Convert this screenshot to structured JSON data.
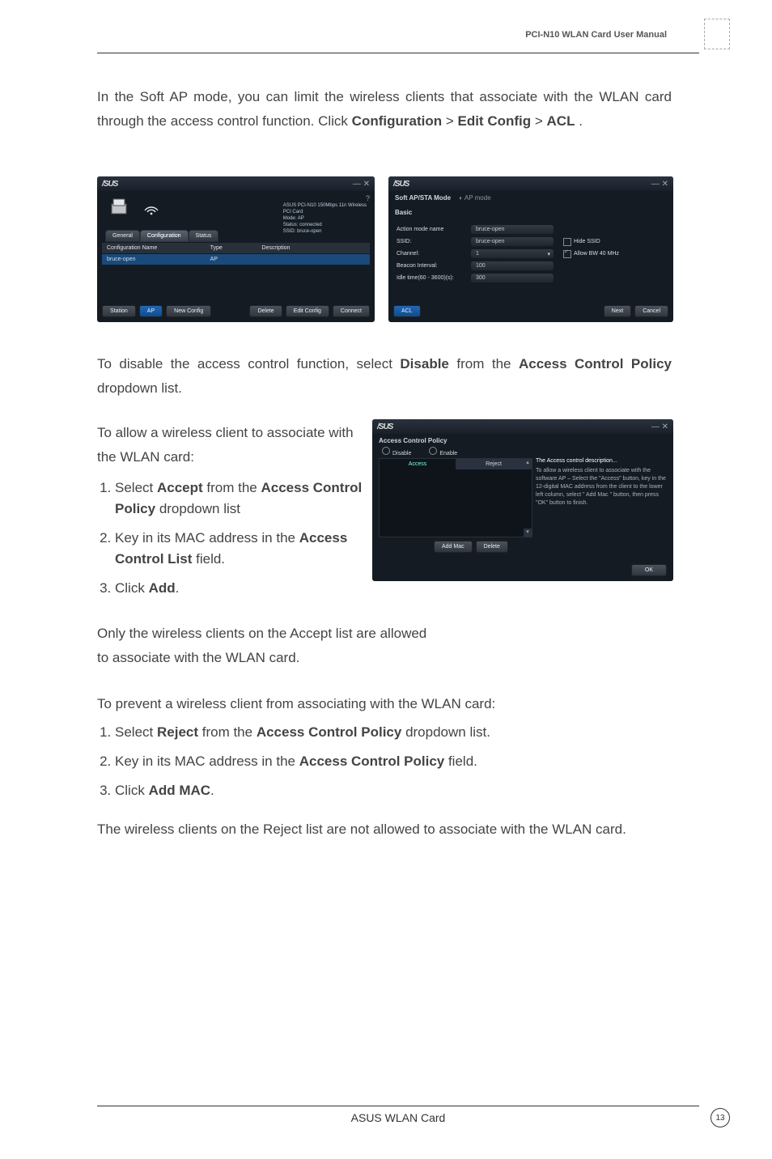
{
  "header": {
    "docTitle": "PCI-N10 WLAN Card User Manual"
  },
  "para1_a": "In the Soft AP mode, you can limit the wireless clients that associate with the WLAN card through the access control function. Click ",
  "para1_b": "Configuration",
  "para1_c": " > ",
  "para1_d": "Edit Config",
  "para1_e": " > ",
  "para1_f": "ACL",
  "para1_g": ".",
  "shot1": {
    "brand": "/SUS",
    "info_l1": "ASUS PCI-N10 150Mbps 11n Wireless",
    "info_l2": "PCI Card",
    "info_l3": "Mode: AP",
    "info_l4": "Status: connected",
    "info_l5": "SSID: bruce-open",
    "tab_general": "General",
    "tab_config": "Configuration",
    "tab_status": "Status",
    "col_name": "Configuration Name",
    "col_type": "Type",
    "col_desc": "Description",
    "row_name": "bruce-open",
    "row_type": "AP",
    "b_station": "Station",
    "b_ap": "AP",
    "b_new": "New Config",
    "b_del": "Delete",
    "b_edit": "Edit Config",
    "b_conn": "Connect"
  },
  "shot2": {
    "brand": "/SUS",
    "titleL": "Soft AP/STA Mode",
    "titleR": "AP mode",
    "sec": "Basic",
    "r1l": "Action mode name",
    "r1v": "bruce-open",
    "r2l": "SSID:",
    "r2v": "bruce-open",
    "r2c": "Hide SSID",
    "r3l": "Channel:",
    "r3v": "1",
    "r3c": "Allow BW 40 MHz",
    "r4l": "Beacon Interval:",
    "r4v": "100",
    "r5l": "Idle time(60 - 3600)(s):",
    "r5v": "300",
    "b_acl": "ACL",
    "b_next": "Next",
    "b_cancel": "Cancel"
  },
  "para2_a": "To disable the access control function, select ",
  "para2_b": "Disable",
  "para2_c": " from the ",
  "para2_d": "Access Control Policy",
  "para2_e": " dropdown list.",
  "para3": "To allow a wireless client to associate with the WLAN card:",
  "steps1": {
    "s1a": "Select ",
    "s1b": "Accept",
    "s1c": " from the ",
    "s1d": "Access Control Policy",
    "s1e": " dropdown list",
    "s2a": "Key in its MAC address in the ",
    "s2b": "Access Control List",
    "s2c": " field.",
    "s3a": "Click ",
    "s3b": "Add",
    "s3c": "."
  },
  "shot3": {
    "brand": "/SUS",
    "heading": "Access Control Policy",
    "rb_disable": "Disable",
    "rb_enable": "Enable",
    "tab_access": "Access",
    "tab_reject": "Reject",
    "desc_t": "The Access control description...",
    "desc_b": "To allow a wireless client to associate with the software AP – Select the \"Access\" button, key in the 12-digital MAC address from the client to the lower left column, select \" Add Mac \" button, then press \"OK\" button to finish.",
    "b_add": "Add Mac",
    "b_del": "Delete",
    "b_ok": "OK"
  },
  "para4": "Only the wireless clients on the Accept list are allowed to associate with the WLAN card.",
  "para5": "To prevent a wireless client from associating with the WLAN card:",
  "steps2": {
    "s1a": "Select ",
    "s1b": "Reject",
    "s1c": " from the ",
    "s1d": "Access Control Policy",
    "s1e": " dropdown list.",
    "s2a": "Key in its MAC address in the ",
    "s2b": "Access Control Policy",
    "s2c": " field.",
    "s3a": "Click ",
    "s3b": "Add MAC",
    "s3c": "."
  },
  "para6": "The wireless clients on the Reject list are not allowed to associate with the WLAN card.",
  "footer": {
    "center": "ASUS WLAN Card",
    "page": "13"
  }
}
